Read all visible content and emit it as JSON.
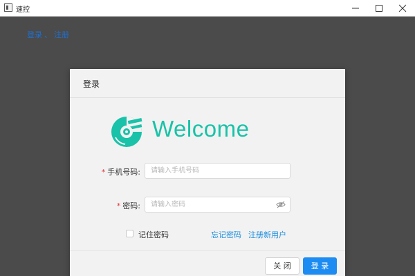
{
  "window": {
    "title": "速控",
    "controls": [
      "minimize-icon",
      "maximize-icon",
      "close-icon"
    ]
  },
  "breadcrumb": {
    "login": "登录",
    "separator": "、",
    "register": "注册"
  },
  "dialog": {
    "title": "登录",
    "logo_text": "Welcome",
    "logo_icon": "disc-logo-icon",
    "phone": {
      "label": "手机号码",
      "colon": ":",
      "required_mark": "*",
      "placeholder": "请输入手机号码",
      "value": ""
    },
    "password": {
      "label": "密码",
      "colon": ":",
      "required_mark": "*",
      "placeholder": "请输入密码",
      "value": "",
      "toggle_icon": "eye-hidden-icon"
    },
    "remember": {
      "label": "记住密码",
      "checked": false
    },
    "forgot_link": "忘记密码",
    "register_link": "注册新用户",
    "buttons": {
      "close": "关 闭",
      "login": "登 录"
    }
  },
  "colors": {
    "background": "#4b4b4b",
    "dialog_bg": "#f2f2f2",
    "brand_teal": "#19c2a8",
    "primary_blue": "#1d8cf2",
    "link_blue": "#1b8ee0",
    "required_red": "#e0383e"
  }
}
